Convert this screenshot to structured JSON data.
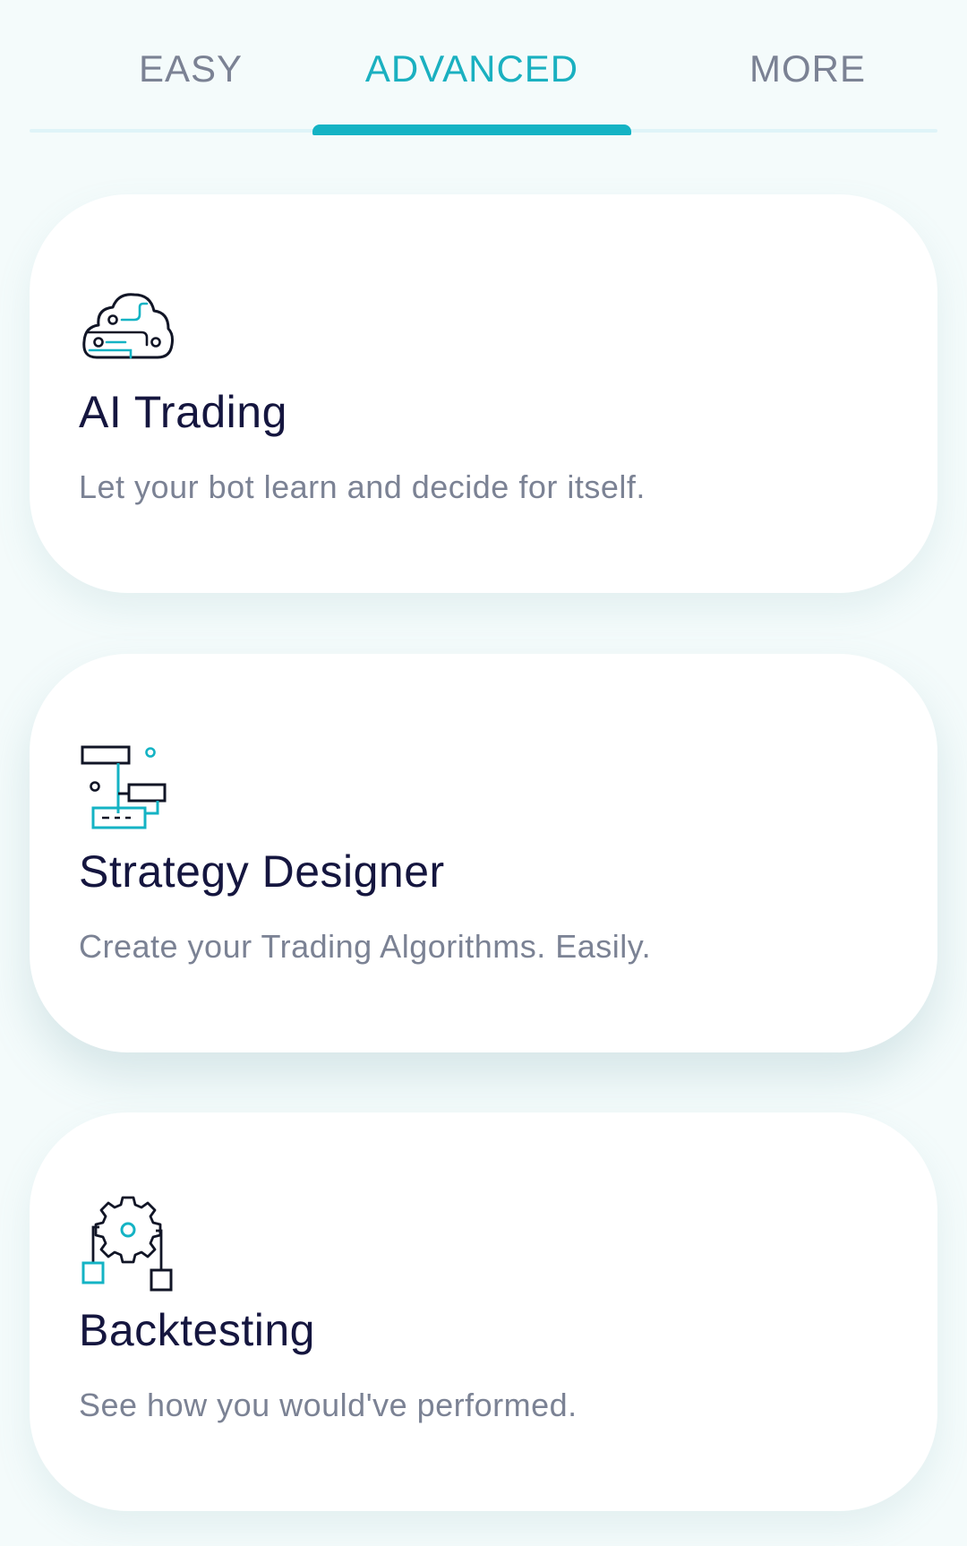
{
  "tabs": [
    {
      "label": "EASY",
      "active": false
    },
    {
      "label": "ADVANCED",
      "active": true
    },
    {
      "label": "MORE",
      "active": false
    }
  ],
  "colors": {
    "accent": "#14b3c4",
    "title": "#15163f",
    "muted": "#7b8294",
    "background": "#f4fbfb",
    "card": "#ffffff"
  },
  "cards": [
    {
      "icon": "ai-cloud-circuit-icon",
      "title": "AI Trading",
      "description": "Let your bot learn and decide for itself."
    },
    {
      "icon": "strategy-flowchart-icon",
      "title": "Strategy Designer",
      "description": "Create your Trading Algorithms. Easily."
    },
    {
      "icon": "backtesting-gear-icon",
      "title": "Backtesting",
      "description": "See how you would've performed."
    }
  ]
}
